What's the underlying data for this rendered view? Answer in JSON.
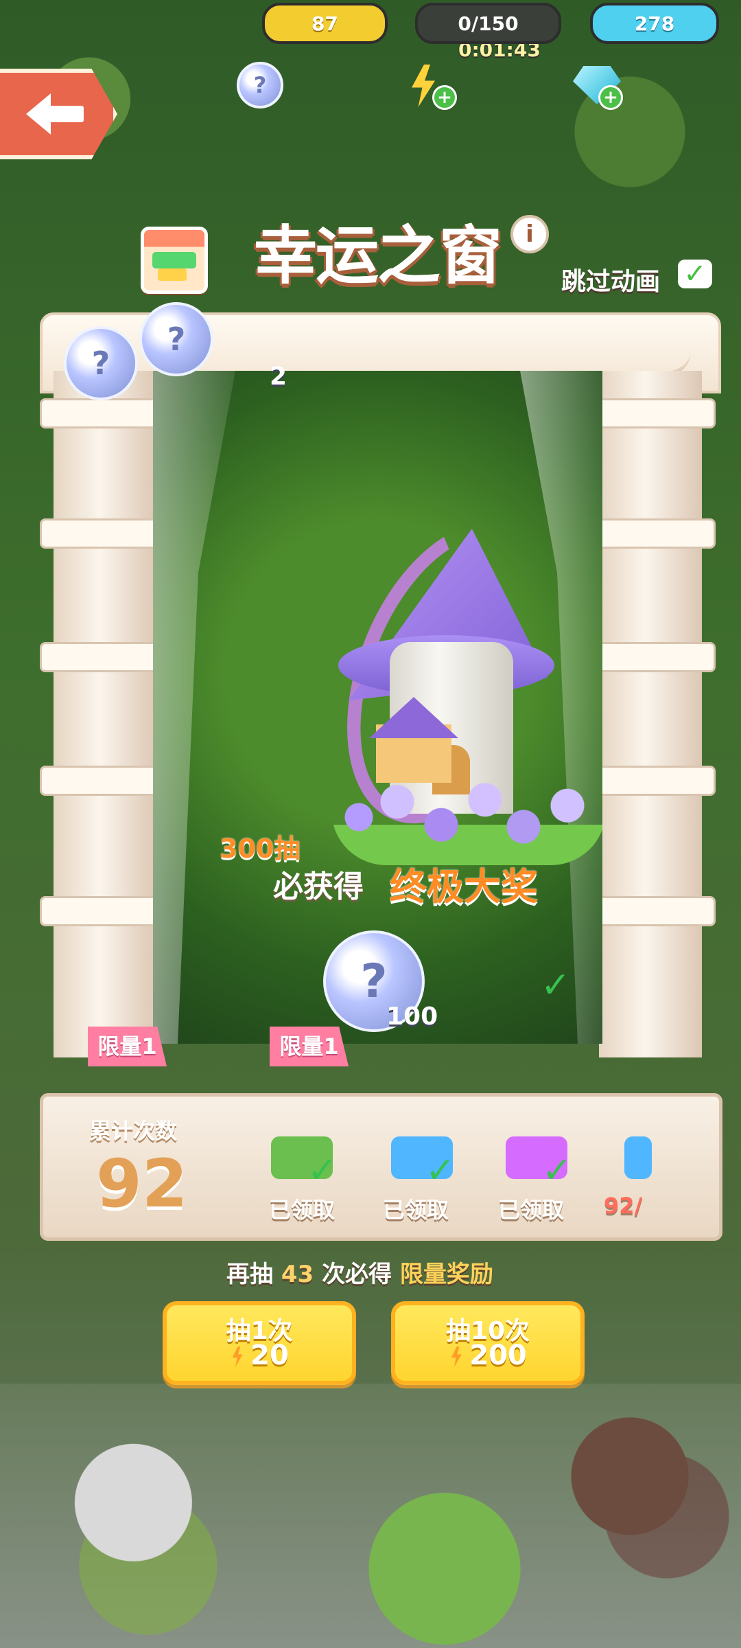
{
  "header": {
    "timer": "0:01:43",
    "coins": "87",
    "energy": "0/150",
    "gems": "278"
  },
  "event": {
    "title": "幸运之窗",
    "skip_animation": "跳过动画"
  },
  "stage": {
    "top_count_2": "2",
    "coin_count_100": "100",
    "limit_label_1": "限量1",
    "limit_label_2": "限量1"
  },
  "promo": {
    "draws": "300抽",
    "guarantee_text": "必获得",
    "grand_prize": "终极大奖"
  },
  "counter": {
    "label": "累计次数",
    "value": "92",
    "rewards": [
      {
        "status": "已领取"
      },
      {
        "status": "已领取"
      },
      {
        "status": "已领取"
      },
      {
        "status": "92/"
      }
    ]
  },
  "pity": {
    "prefix": "再抽",
    "count": "43",
    "middle": "次必得",
    "reward": "限量奖励"
  },
  "actions": {
    "single_draw_label": "抽1次",
    "single_draw_cost": "20",
    "ten_draw_label": "抽10次",
    "ten_draw_cost": "200"
  },
  "icons": {
    "back": "back-arrow-icon",
    "coin": "coin-icon",
    "energy": "energy-icon",
    "gem": "gem-icon",
    "shop": "shop-icon",
    "info": "info-icon",
    "check": "check-icon"
  },
  "colors": {
    "orange": "#e8664c",
    "yellow": "#f3cd2f",
    "blue": "#50d0ef",
    "green": "#37c14f",
    "pink": "#ff7ea1",
    "purple": "#8c68d8"
  }
}
